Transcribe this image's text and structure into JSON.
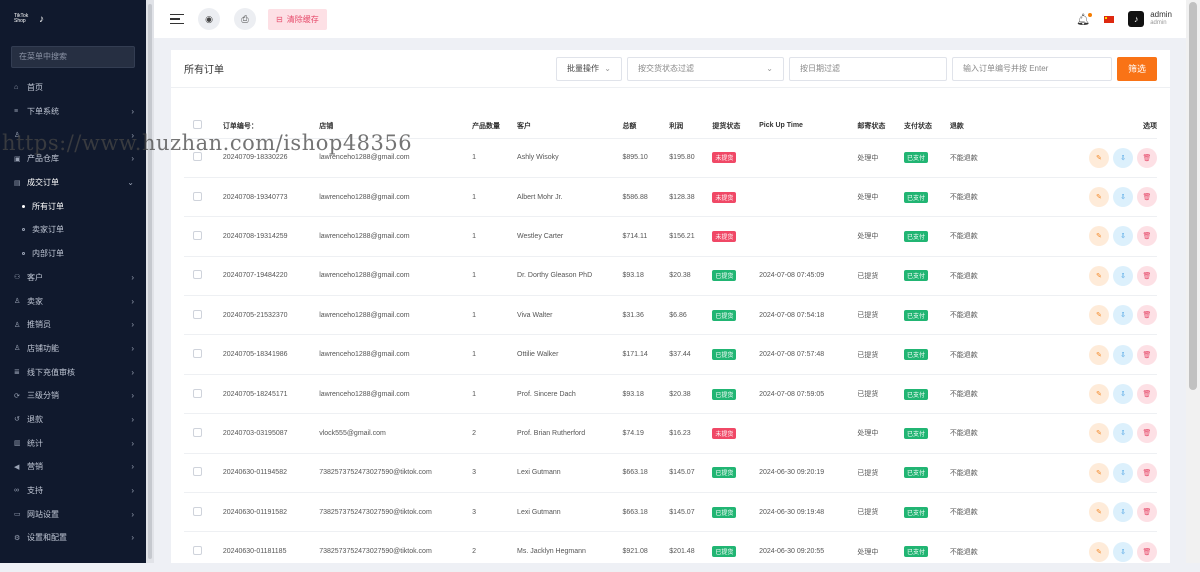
{
  "sidebar": {
    "logo_text": "TikTok Shop",
    "search_placeholder": "在菜单中搜索",
    "items": [
      {
        "label": "首页",
        "icon": "home-icon",
        "chevron": false
      },
      {
        "label": "下单系统",
        "icon": "list-icon",
        "chevron": true
      },
      {
        "label": "",
        "icon": "user-icon",
        "chevron": true
      },
      {
        "label": "产品仓库",
        "icon": "box-icon",
        "chevron": true
      },
      {
        "label": "成交订单",
        "icon": "order-icon",
        "chevron": true,
        "expanded": true
      },
      {
        "label": "所有订单",
        "sub": true,
        "active": true
      },
      {
        "label": "卖家订单",
        "sub": true
      },
      {
        "label": "内部订单",
        "sub": true
      },
      {
        "label": "客户",
        "icon": "users-icon",
        "chevron": true
      },
      {
        "label": "卖家",
        "icon": "user-icon",
        "chevron": true
      },
      {
        "label": "推销员",
        "icon": "user-icon",
        "chevron": true
      },
      {
        "label": "店铺功能",
        "icon": "user-icon",
        "chevron": true
      },
      {
        "label": "线下充值审核",
        "icon": "money-icon",
        "chevron": true
      },
      {
        "label": "三级分销",
        "icon": "share-icon",
        "chevron": true
      },
      {
        "label": "退款",
        "icon": "refund-icon",
        "chevron": true
      },
      {
        "label": "统计",
        "icon": "chart-icon",
        "chevron": true
      },
      {
        "label": "营销",
        "icon": "megaphone-icon",
        "chevron": true
      },
      {
        "label": "支持",
        "icon": "link-icon",
        "chevron": true
      },
      {
        "label": "网站设置",
        "icon": "monitor-icon",
        "chevron": true
      },
      {
        "label": "设置和配置",
        "icon": "gear-icon",
        "chevron": true
      }
    ]
  },
  "topbar": {
    "clear_cache": "清除缓存",
    "user_name": "admin",
    "user_role": "admin"
  },
  "card": {
    "title": "所有订单",
    "bulk_action": "批量操作",
    "delivery_filter": "按交货状态过滤",
    "date_filter": "按日期过滤",
    "order_search_placeholder": "输入订单编号并按 Enter",
    "filter_button": "筛选"
  },
  "table": {
    "headers": [
      "订单编号：",
      "店铺",
      "产品数量",
      "客户",
      "总额",
      "利润",
      "提货状态",
      "Pick Up Time",
      "邮寄状态",
      "支付状态",
      "退款",
      "选项"
    ],
    "rows": [
      {
        "order": "20240709-18330226",
        "shop": "lawrenceho1288@gmail.com",
        "qty": "1",
        "customer": "Ashly Wisoky",
        "total": "$895.10",
        "profit": "$195.80",
        "pickup": "未提货",
        "pickup_ok": false,
        "pickup_time": "",
        "ship": "处理中",
        "pay": "已支付",
        "refund": "不能退款"
      },
      {
        "order": "20240708-19340773",
        "shop": "lawrenceho1288@gmail.com",
        "qty": "1",
        "customer": "Albert Mohr Jr.",
        "total": "$586.88",
        "profit": "$128.38",
        "pickup": "未提货",
        "pickup_ok": false,
        "pickup_time": "",
        "ship": "处理中",
        "pay": "已支付",
        "refund": "不能退款"
      },
      {
        "order": "20240708-19314259",
        "shop": "lawrenceho1288@gmail.com",
        "qty": "1",
        "customer": "Westley Carter",
        "total": "$714.11",
        "profit": "$156.21",
        "pickup": "未提货",
        "pickup_ok": false,
        "pickup_time": "",
        "ship": "处理中",
        "pay": "已支付",
        "refund": "不能退款"
      },
      {
        "order": "20240707-19484220",
        "shop": "lawrenceho1288@gmail.com",
        "qty": "1",
        "customer": "Dr. Dorthy Gleason PhD",
        "total": "$93.18",
        "profit": "$20.38",
        "pickup": "已提货",
        "pickup_ok": true,
        "pickup_time": "2024-07-08 07:45:09",
        "ship": "已提货",
        "pay": "已支付",
        "refund": "不能退款"
      },
      {
        "order": "20240705-21532370",
        "shop": "lawrenceho1288@gmail.com",
        "qty": "1",
        "customer": "Viva Walter",
        "total": "$31.36",
        "profit": "$6.86",
        "pickup": "已提货",
        "pickup_ok": true,
        "pickup_time": "2024-07-08 07:54:18",
        "ship": "已提货",
        "pay": "已支付",
        "refund": "不能退款"
      },
      {
        "order": "20240705-18341986",
        "shop": "lawrenceho1288@gmail.com",
        "qty": "1",
        "customer": "Ottilie Walker",
        "total": "$171.14",
        "profit": "$37.44",
        "pickup": "已提货",
        "pickup_ok": true,
        "pickup_time": "2024-07-08 07:57:48",
        "ship": "已提货",
        "pay": "已支付",
        "refund": "不能退款"
      },
      {
        "order": "20240705-18245171",
        "shop": "lawrenceho1288@gmail.com",
        "qty": "1",
        "customer": "Prof. Sincere Dach",
        "total": "$93.18",
        "profit": "$20.38",
        "pickup": "已提货",
        "pickup_ok": true,
        "pickup_time": "2024-07-08 07:59:05",
        "ship": "已提货",
        "pay": "已支付",
        "refund": "不能退款"
      },
      {
        "order": "20240703-03195087",
        "shop": "vlock555@gmail.com",
        "qty": "2",
        "customer": "Prof. Brian Rutherford",
        "total": "$74.19",
        "profit": "$16.23",
        "pickup": "未提货",
        "pickup_ok": false,
        "pickup_time": "",
        "ship": "处理中",
        "pay": "已支付",
        "refund": "不能退款"
      },
      {
        "order": "20240630-01194582",
        "shop": "7382573752473027590@tiktok.com",
        "qty": "3",
        "customer": "Lexi Gutmann",
        "total": "$663.18",
        "profit": "$145.07",
        "pickup": "已提货",
        "pickup_ok": true,
        "pickup_time": "2024-06-30 09:20:19",
        "ship": "已提货",
        "pay": "已支付",
        "refund": "不能退款"
      },
      {
        "order": "20240630-01191582",
        "shop": "7382573752473027590@tiktok.com",
        "qty": "3",
        "customer": "Lexi Gutmann",
        "total": "$663.18",
        "profit": "$145.07",
        "pickup": "已提货",
        "pickup_ok": true,
        "pickup_time": "2024-06-30 09:19:48",
        "ship": "已提货",
        "pay": "已支付",
        "refund": "不能退款"
      },
      {
        "order": "20240630-01181185",
        "shop": "7382573752473027590@tiktok.com",
        "qty": "2",
        "customer": "Ms. Jacklyn Hegmann",
        "total": "$921.08",
        "profit": "$201.48",
        "pickup": "已提货",
        "pickup_ok": true,
        "pickup_time": "2024-06-30 09:20:55",
        "ship": "处理中",
        "pay": "已支付",
        "refund": "不能退款"
      }
    ]
  },
  "watermark": "https://www.huzhan.com/ishop48356"
}
